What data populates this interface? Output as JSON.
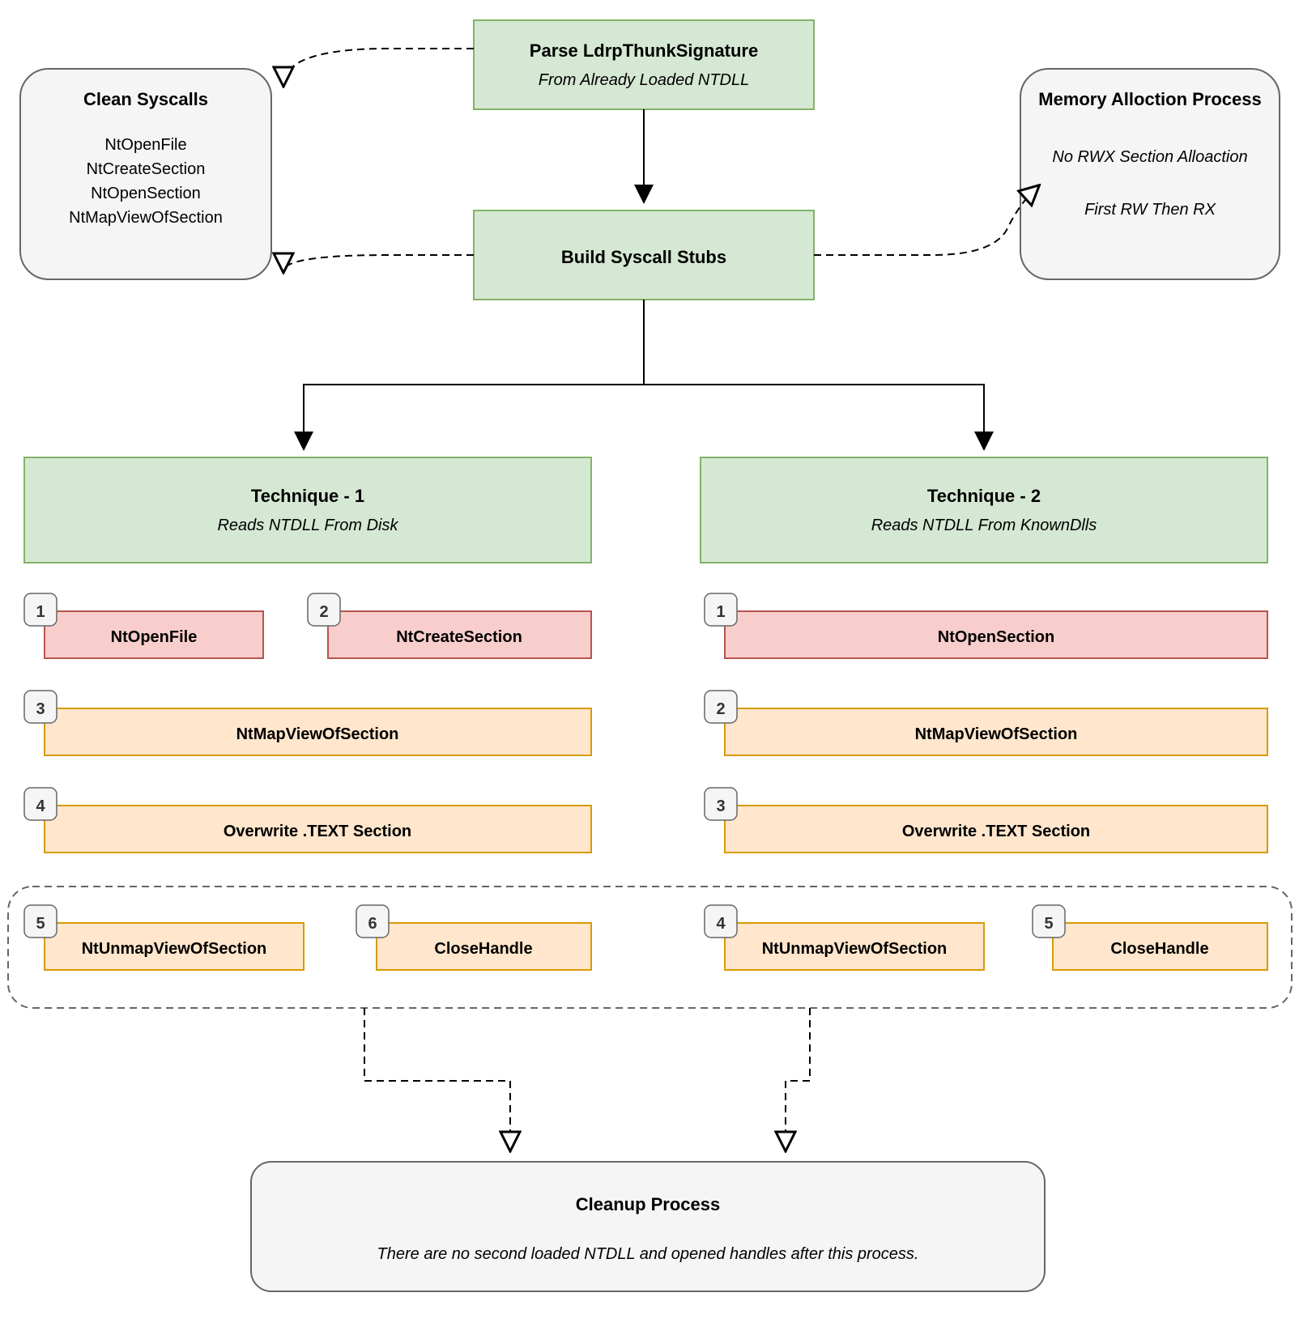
{
  "top": {
    "parse_title": "Parse LdrpThunkSignature",
    "parse_sub": "From Already Loaded NTDLL",
    "build_title": "Build Syscall Stubs"
  },
  "clean": {
    "title": "Clean Syscalls",
    "items": [
      "NtOpenFile",
      "NtCreateSection",
      "NtOpenSection",
      "NtMapViewOfSection"
    ]
  },
  "mem": {
    "title": "Memory Alloction Process",
    "line1": "No RWX Section Alloaction",
    "line2": "First RW Then RX"
  },
  "technique1": {
    "title": "Technique - 1",
    "sub": "Reads NTDLL From Disk",
    "steps": [
      {
        "n": "1",
        "label": "NtOpenFile",
        "color": "pink"
      },
      {
        "n": "2",
        "label": "NtCreateSection",
        "color": "pink"
      },
      {
        "n": "3",
        "label": "NtMapViewOfSection",
        "color": "orange"
      },
      {
        "n": "4",
        "label": "Overwrite .TEXT Section",
        "color": "orange"
      },
      {
        "n": "5",
        "label": "NtUnmapViewOfSection",
        "color": "orange"
      },
      {
        "n": "6",
        "label": "CloseHandle",
        "color": "orange"
      }
    ]
  },
  "technique2": {
    "title": "Technique - 2",
    "sub": "Reads NTDLL From KnownDlls",
    "steps": [
      {
        "n": "1",
        "label": "NtOpenSection",
        "color": "pink"
      },
      {
        "n": "2",
        "label": "NtMapViewOfSection",
        "color": "orange"
      },
      {
        "n": "3",
        "label": "Overwrite .TEXT Section",
        "color": "orange"
      },
      {
        "n": "4",
        "label": "NtUnmapViewOfSection",
        "color": "orange"
      },
      {
        "n": "5",
        "label": "CloseHandle",
        "color": "orange"
      }
    ]
  },
  "cleanup": {
    "title": "Cleanup Process",
    "sub": "There are no second loaded NTDLL and opened handles after this process."
  }
}
